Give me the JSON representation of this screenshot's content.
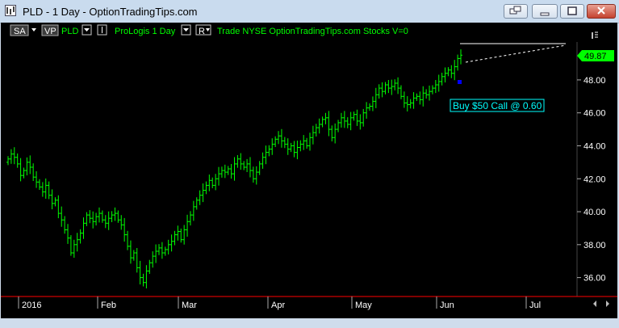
{
  "window": {
    "title": "PLD - 1 Day - OptionTradingTips.com"
  },
  "toolbar": {
    "sa_label": "SA",
    "vp_label": "VP",
    "symbol": "PLD",
    "name_label": "ProLogis  1 Day",
    "r_label": "R",
    "info_label": "Trade  NYSE  OptionTradingTips.com  Stocks  V=0"
  },
  "price_axis": {
    "ticks": [
      "48.00",
      "46.00",
      "44.00",
      "42.00",
      "40.00",
      "38.00",
      "36.00"
    ],
    "last_price": "49.87"
  },
  "time_axis": {
    "labels": [
      "2016",
      "Feb",
      "Mar",
      "Apr",
      "May",
      "Jun",
      "Jul"
    ]
  },
  "annotation": {
    "text": "Buy $50 Call @ 0.60"
  },
  "colors": {
    "background": "#000000",
    "bars": "#00ff00",
    "axis": "#ff0000",
    "annotation": "#00ffff",
    "signal": "#0000ff",
    "price_tag": "#00ff00"
  },
  "chart_data": {
    "type": "bar",
    "style": "ohlc",
    "series": [
      {
        "values": [
          43.2,
          43.5,
          43.3,
          42.9,
          42.2,
          42.5,
          43.0,
          42.7,
          42.1,
          41.8,
          41.5,
          41.2,
          41.6,
          41.0,
          40.5,
          40.7,
          39.9,
          39.5,
          38.9,
          38.4,
          37.5,
          38.0,
          38.3,
          38.7,
          39.3,
          39.8,
          39.6,
          39.4,
          39.7,
          39.9,
          39.5,
          39.3,
          39.6,
          39.8,
          39.9,
          39.5,
          39.2,
          38.6,
          37.9,
          37.2,
          37.5,
          36.6,
          36.0,
          35.7,
          36.4,
          36.9,
          37.3,
          37.6,
          37.8,
          37.5,
          37.7,
          38.0,
          38.2,
          38.6,
          38.8,
          38.3,
          38.9,
          39.4,
          39.8,
          40.3,
          40.7,
          41.0,
          41.3,
          41.6,
          41.9,
          41.6,
          42.0,
          42.3,
          42.5,
          42.4,
          42.6,
          42.3,
          42.9,
          43.2,
          42.9,
          42.7,
          42.9,
          42.5,
          42.0,
          42.4,
          42.9,
          43.3,
          43.6,
          43.8,
          44.1,
          44.4,
          44.6,
          44.3,
          44.1,
          43.8,
          44.0,
          43.6,
          43.9,
          44.1,
          44.3,
          44.0,
          44.5,
          44.8,
          45.1,
          45.3,
          45.6,
          45.7,
          45.0,
          44.5,
          45.0,
          45.4,
          45.7,
          45.5,
          45.3,
          45.7,
          45.9,
          45.5,
          45.4,
          46.0,
          46.3,
          46.4,
          46.7,
          47.1,
          47.5,
          47.3,
          47.7,
          47.5,
          47.6,
          47.8,
          47.5,
          47.0,
          46.6,
          46.5,
          46.6,
          46.9,
          47.0,
          46.8,
          47.2,
          47.1,
          47.3,
          47.5,
          47.7,
          47.9,
          48.2,
          48.4,
          48.6,
          48.4,
          48.8,
          49.3,
          49.5
        ]
      }
    ],
    "ylim": [
      35.0,
      50.3
    ],
    "y_ticks": [
      36,
      38,
      40,
      42,
      44,
      46,
      48
    ],
    "x_labels": [
      "2016",
      "Feb",
      "Mar",
      "Apr",
      "May",
      "Jun",
      "Jul"
    ],
    "last_price": 49.87,
    "grid": false,
    "legend": "none"
  }
}
